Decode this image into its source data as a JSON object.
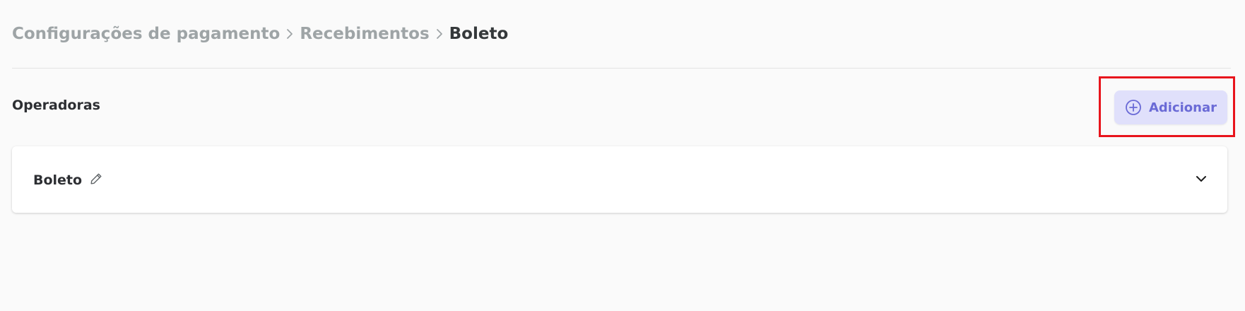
{
  "breadcrumb": {
    "items": [
      "Configurações de pagamento",
      "Recebimentos"
    ],
    "current": "Boleto",
    "separator_icon": "chevron-right-icon"
  },
  "section": {
    "title": "Operadoras"
  },
  "actions": {
    "add_label": "Adicionar",
    "add_icon": "plus-circle-icon"
  },
  "operators": [
    {
      "name": "Boleto",
      "edit_icon": "pencil-icon",
      "expand_icon": "chevron-down-icon"
    }
  ],
  "colors": {
    "background": "#fafafa",
    "breadcrumb_muted": "#9ea4a6",
    "text_dark": "#2d2f33",
    "button_bg": "#e0e0fb",
    "button_text": "#6a6ad6",
    "highlight": "#e8141c"
  }
}
